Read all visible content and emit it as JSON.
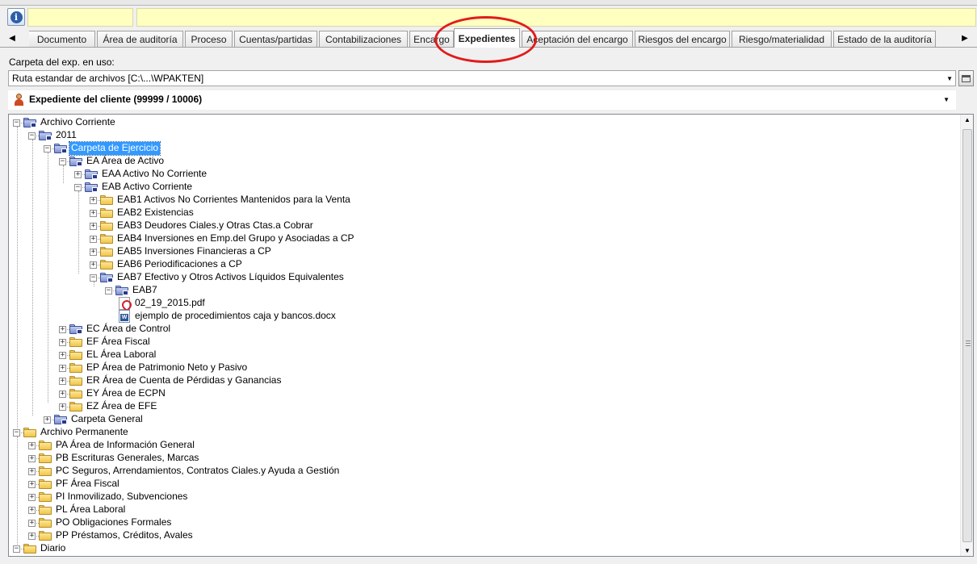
{
  "toolbar": {
    "info_icon": "info-icon"
  },
  "tabs": [
    {
      "label": "Documento",
      "active": false
    },
    {
      "label": "Área de auditoría",
      "active": false
    },
    {
      "label": "Proceso",
      "active": false
    },
    {
      "label": "Cuentas/partidas",
      "active": false
    },
    {
      "label": "Contabilizaciones",
      "active": false
    },
    {
      "label": "Encargo",
      "active": false
    },
    {
      "label": "Expedientes",
      "active": true
    },
    {
      "label": "Aceptación del encargo",
      "active": false
    },
    {
      "label": "Riesgos del encargo",
      "active": false
    },
    {
      "label": "Riesgo/materialidad",
      "active": false
    },
    {
      "label": "Estado de la auditoría",
      "active": false
    }
  ],
  "carpeta": {
    "label": "Carpeta del exp. en uso:",
    "path": "Ruta estandar de archivos [C:\\...\\WPAKTEN]"
  },
  "client": {
    "label": "Expediente del cliente (99999 / 10006)"
  },
  "annotation": {
    "color": "#e21b1b"
  },
  "tree": [
    {
      "label": "Archivo Corriente",
      "level": 0,
      "expanded": true,
      "icon": "folder-blue"
    },
    {
      "label": "2011",
      "level": 1,
      "expanded": true,
      "icon": "folder-blue"
    },
    {
      "label": "Carpeta de Ejercicio",
      "level": 2,
      "expanded": true,
      "icon": "folder-blue-open",
      "selected": true
    },
    {
      "label": "EA Área de Activo",
      "level": 3,
      "expanded": true,
      "icon": "folder-blue"
    },
    {
      "label": "EAA Activo No Corriente",
      "level": 4,
      "expanded": false,
      "icon": "folder-blue"
    },
    {
      "label": "EAB Activo Corriente",
      "level": 4,
      "expanded": true,
      "icon": "folder-blue"
    },
    {
      "label": "EAB1 Activos No Corrientes Mantenidos para la Venta",
      "level": 5,
      "expanded": false,
      "icon": "folder"
    },
    {
      "label": "EAB2 Existencias",
      "level": 5,
      "expanded": false,
      "icon": "folder"
    },
    {
      "label": "EAB3 Deudores Ciales.y Otras Ctas.a Cobrar",
      "level": 5,
      "expanded": false,
      "icon": "folder"
    },
    {
      "label": "EAB4 Inversiones en Emp.del Grupo y Asociadas a CP",
      "level": 5,
      "expanded": false,
      "icon": "folder"
    },
    {
      "label": "EAB5 Inversiones Financieras a CP",
      "level": 5,
      "expanded": false,
      "icon": "folder"
    },
    {
      "label": "EAB6 Periodificaciones a CP",
      "level": 5,
      "expanded": false,
      "icon": "folder"
    },
    {
      "label": "EAB7 Efectivo y Otros Activos Líquidos Equivalentes",
      "level": 5,
      "expanded": true,
      "icon": "folder-blue"
    },
    {
      "label": "EAB7",
      "level": 6,
      "expanded": true,
      "icon": "folder-blue"
    },
    {
      "label": "02_19_2015.pdf",
      "level": 7,
      "icon": "pdf"
    },
    {
      "label": "ejemplo de procedimientos caja y bancos.docx",
      "level": 7,
      "icon": "docx"
    },
    {
      "label": "EC Área de Control",
      "level": 3,
      "expanded": false,
      "icon": "folder-blue"
    },
    {
      "label": "EF Área Fiscal",
      "level": 3,
      "expanded": false,
      "icon": "folder"
    },
    {
      "label": "EL Área Laboral",
      "level": 3,
      "expanded": false,
      "icon": "folder"
    },
    {
      "label": "EP Área de Patrimonio Neto y Pasivo",
      "level": 3,
      "expanded": false,
      "icon": "folder"
    },
    {
      "label": "ER Área de Cuenta de Pérdidas y Ganancias",
      "level": 3,
      "expanded": false,
      "icon": "folder"
    },
    {
      "label": "EY Área de ECPN",
      "level": 3,
      "expanded": false,
      "icon": "folder"
    },
    {
      "label": "EZ Área de EFE",
      "level": 3,
      "expanded": false,
      "icon": "folder"
    },
    {
      "label": "Carpeta General",
      "level": 2,
      "expanded": false,
      "icon": "folder-blue"
    },
    {
      "label": "Archivo Permanente",
      "level": 0,
      "expanded": true,
      "icon": "folder"
    },
    {
      "label": "PA Área de Información General",
      "level": 1,
      "expanded": false,
      "icon": "folder"
    },
    {
      "label": "PB Escrituras Generales, Marcas",
      "level": 1,
      "expanded": false,
      "icon": "folder"
    },
    {
      "label": "PC Seguros, Arrendamientos, Contratos Ciales.y Ayuda a Gestión",
      "level": 1,
      "expanded": false,
      "icon": "folder"
    },
    {
      "label": "PF Área Fiscal",
      "level": 1,
      "expanded": false,
      "icon": "folder"
    },
    {
      "label": "PI Inmovilizado, Subvenciones",
      "level": 1,
      "expanded": false,
      "icon": "folder"
    },
    {
      "label": "PL Área Laboral",
      "level": 1,
      "expanded": false,
      "icon": "folder"
    },
    {
      "label": "PO Obligaciones Formales",
      "level": 1,
      "expanded": false,
      "icon": "folder"
    },
    {
      "label": "PP Préstamos, Créditos, Avales",
      "level": 1,
      "expanded": false,
      "icon": "folder"
    },
    {
      "label": "Diario",
      "level": 0,
      "expanded": true,
      "icon": "folder"
    }
  ]
}
